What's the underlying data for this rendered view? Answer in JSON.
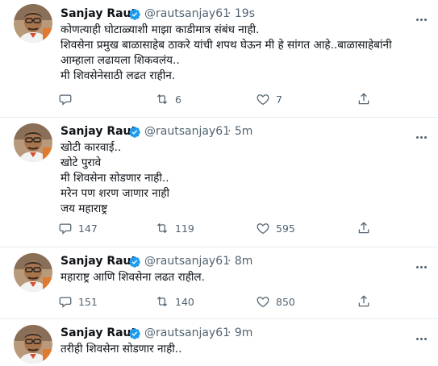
{
  "tweets": [
    {
      "name": "Sanjay Raut",
      "handle": "@rautsanjay61",
      "time": "· 19s",
      "lines": [
        "कोणत्याही घोटाळ्याशी माझा काडीमात्र संबंध नाही.",
        "शिवसेना प्रमुख बाळासाहेब ठाकरे यांची शपथ घेऊन मी हे सांगत आहे..बाळासाहेबांनी",
        "आम्हाला लढायला शिकवलंय..",
        "मी शिवसेनेसाठी लढत राहीन."
      ],
      "reply_count": "",
      "retweet_count": "6",
      "like_count": "7"
    },
    {
      "name": "Sanjay Raut",
      "handle": "@rautsanjay61",
      "time": "· 5m",
      "lines": [
        "खोटी कारवाई..",
        "खोटे पुरावे",
        "मी शिवसेना सोडणार नाही..",
        "मरेन पण शरण जाणार नाही",
        "जय महाराष्ट्र"
      ],
      "reply_count": "147",
      "retweet_count": "119",
      "like_count": "595"
    },
    {
      "name": "Sanjay Raut",
      "handle": "@rautsanjay61",
      "time": "· 8m",
      "lines": [
        "महाराष्ट्र आणि शिवसेना लढत राहील."
      ],
      "reply_count": "151",
      "retweet_count": "140",
      "like_count": "850"
    },
    {
      "name": "Sanjay Raut",
      "handle": "@rautsanjay61",
      "time": "· 9m",
      "lines": [
        "तरीही शिवसेना सोडणार नाही.."
      ],
      "reply_count": "",
      "retweet_count": "",
      "like_count": ""
    }
  ],
  "colors": {
    "verified": "#1d9bf0",
    "text": "#0f1419",
    "secondary": "#536471",
    "divider": "#e6ecf0"
  },
  "icons": {
    "verified": "verified-badge-icon",
    "more": "more-horizontal-icon",
    "reply": "reply-icon",
    "retweet": "retweet-icon",
    "like": "heart-icon",
    "share": "share-icon"
  }
}
